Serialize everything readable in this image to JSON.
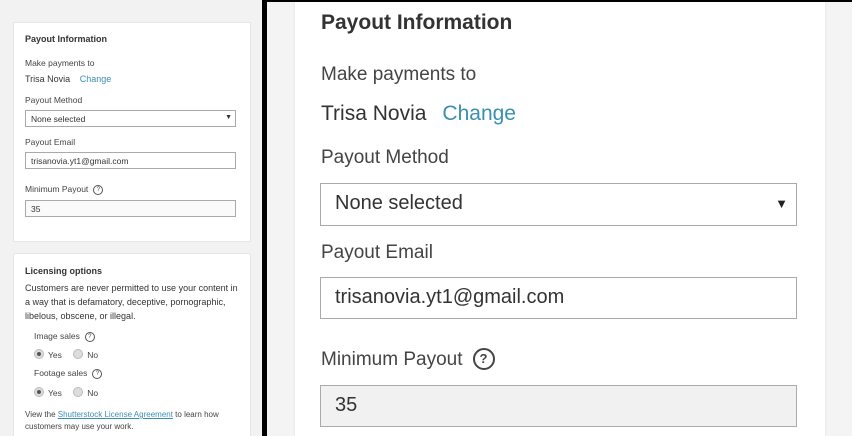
{
  "payout": {
    "title": "Payout Information",
    "make_payments_label": "Make payments to",
    "payee_name": "Trisa Novia",
    "change_link": "Change",
    "method_label": "Payout Method",
    "method_value": "None selected",
    "email_label": "Payout Email",
    "email_value": "trisanovia.yt1@gmail.com",
    "minimum_label": "Minimum Payout",
    "minimum_value": "35",
    "help_glyph": "?"
  },
  "licensing": {
    "title": "Licensing options",
    "description": "Customers are never permitted to use your content in a way that is defamatory, deceptive, pornographic, libelous, obscene, or illegal.",
    "image_sales_label": "Image sales",
    "footage_sales_label": "Footage sales",
    "yes_label": "Yes",
    "no_label": "No",
    "image_sales_selected": "Yes",
    "footage_sales_selected": "Yes",
    "footer_prefix": "View the ",
    "footer_link": "Shutterstock License Agreement",
    "footer_suffix": " to learn how customers may use your work."
  },
  "icons": {
    "dropdown": "caret-down-icon",
    "help": "question-circle-icon"
  },
  "colors": {
    "link": "#3a8fb0",
    "panel_bg": "#f2f2f2"
  }
}
